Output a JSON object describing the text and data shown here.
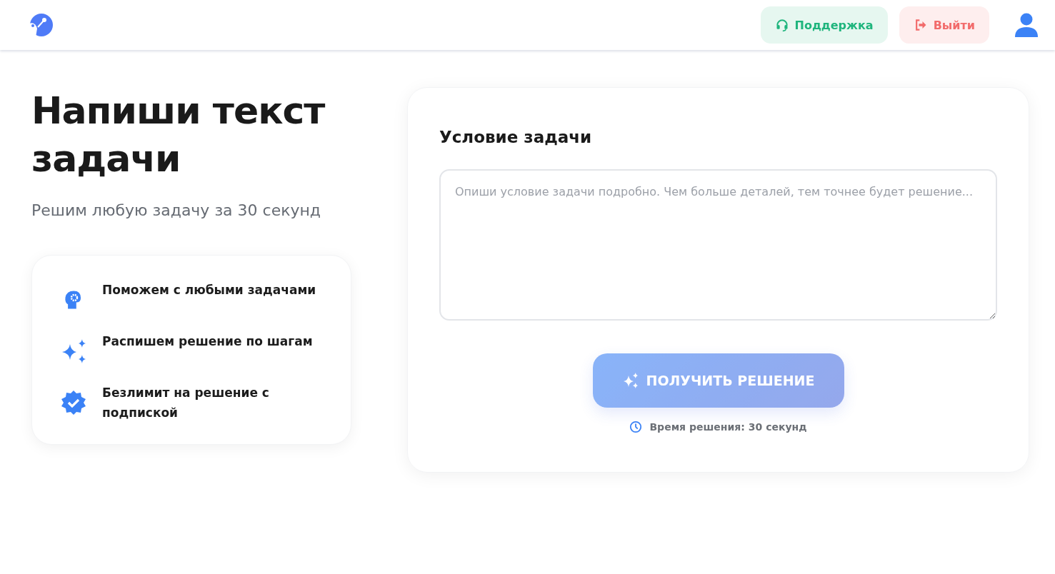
{
  "header": {
    "buttons": [
      {
        "kind": "support",
        "label": "Поддержка"
      },
      {
        "kind": "logout",
        "label": "Выйти"
      }
    ]
  },
  "hero": {
    "title": "Напиши текст задачи",
    "subtitle": "Решим любую задачу за 30 секунд"
  },
  "features": [
    {
      "kind": "brain",
      "text": "Поможем с любыми задачами"
    },
    {
      "kind": "sparkles",
      "text": "Распишем решение по шагам"
    },
    {
      "kind": "badge",
      "text": "Безлимит на решение с подпиской"
    }
  ],
  "form": {
    "heading": "Условие задачи",
    "placeholder": "Опиши условие задачи подробно. Чем больше деталей, тем точнее будет решение...",
    "submit": {
      "label": "ПОЛУЧИТЬ РЕШЕНИЕ",
      "disabled": true
    },
    "note": "Время решения: 30 секунд"
  }
}
